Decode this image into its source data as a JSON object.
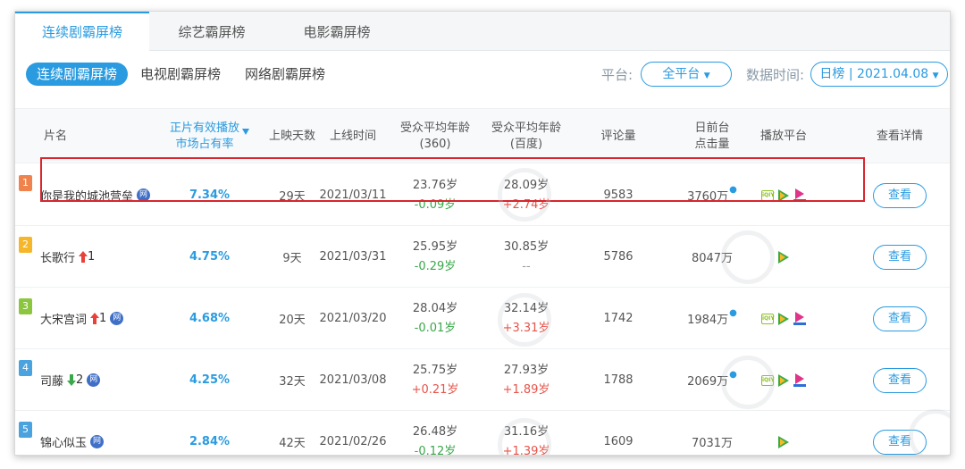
{
  "top_tabs": [
    "连续剧霸屏榜",
    "综艺霸屏榜",
    "电影霸屏榜"
  ],
  "sub_tabs": [
    "连续剧霸屏榜",
    "电视剧霸屏榜",
    "网络剧霸屏榜"
  ],
  "filters": {
    "platform_label": "平台:",
    "platform_value": "全平台",
    "date_label": "数据时间:",
    "date_value": "日榜 | 2021.04.08"
  },
  "columns": {
    "name": "片名",
    "share_line1": "正片有效播放",
    "share_line2": "市场占有率",
    "days": "上映天数",
    "release": "上线时间",
    "age360_line1": "受众平均年龄",
    "age360_line2": "(360)",
    "agebaidu_line1": "受众平均年龄",
    "agebaidu_line2": "(百度)",
    "comments": "评论量",
    "clicks_line1": "日前台",
    "clicks_line2": "点击量",
    "platforms": "播放平台",
    "detail": "查看详情"
  },
  "rows": [
    {
      "rank": "1",
      "rank_color": "#f0834d",
      "name": "你是我的城池营垒",
      "change": "",
      "change_dir": "",
      "wang": true,
      "share": "7.34%",
      "days": "29天",
      "release": "2021/03/11",
      "age360": "23.76岁",
      "age360_delta": "-0.09岁",
      "age360_dir": "down",
      "agebaidu": "28.09岁",
      "agebaidu_delta": "+2.74岁",
      "agebaidu_dir": "up",
      "comments": "9583",
      "clicks": "3760万",
      "platforms": [
        "iqiyi",
        "tencent",
        "youku"
      ],
      "detail": "查看"
    },
    {
      "rank": "2",
      "rank_color": "#f5b62a",
      "name": "长歌行",
      "change": "1",
      "change_dir": "up",
      "wang": false,
      "share": "4.75%",
      "days": "9天",
      "release": "2021/03/31",
      "age360": "25.95岁",
      "age360_delta": "-0.29岁",
      "age360_dir": "down",
      "agebaidu": "30.85岁",
      "agebaidu_delta": "--",
      "agebaidu_dir": "none",
      "comments": "5786",
      "clicks": "8047万",
      "platforms": [
        "tencent"
      ],
      "detail": "查看"
    },
    {
      "rank": "3",
      "rank_color": "#8cc63f",
      "name": "大宋宫词",
      "change": "1",
      "change_dir": "up",
      "wang": true,
      "share": "4.68%",
      "days": "20天",
      "release": "2021/03/20",
      "age360": "28.04岁",
      "age360_delta": "-0.01岁",
      "age360_dir": "down",
      "agebaidu": "32.14岁",
      "agebaidu_delta": "+3.31岁",
      "agebaidu_dir": "up",
      "comments": "1742",
      "clicks": "1984万",
      "platforms": [
        "iqiyi",
        "tencent",
        "youku"
      ],
      "detail": "查看"
    },
    {
      "rank": "4",
      "rank_color": "#4aa3df",
      "name": "司藤",
      "change": "2",
      "change_dir": "down",
      "wang": true,
      "share": "4.25%",
      "days": "32天",
      "release": "2021/03/08",
      "age360": "25.75岁",
      "age360_delta": "+0.21岁",
      "age360_dir": "up",
      "agebaidu": "27.93岁",
      "agebaidu_delta": "+1.89岁",
      "agebaidu_dir": "up",
      "comments": "1788",
      "clicks": "2069万",
      "platforms": [
        "iqiyi",
        "tencent",
        "youku"
      ],
      "detail": "查看"
    },
    {
      "rank": "5",
      "rank_color": "#4aa3df",
      "name": "锦心似玉",
      "change": "",
      "change_dir": "",
      "wang": true,
      "share": "2.84%",
      "days": "42天",
      "release": "2021/02/26",
      "age360": "26.48岁",
      "age360_delta": "-0.12岁",
      "age360_dir": "down",
      "agebaidu": "31.16岁",
      "agebaidu_delta": "+1.39岁",
      "agebaidu_dir": "up",
      "comments": "1609",
      "clicks": "7031万",
      "platforms": [
        "tencent"
      ],
      "detail": "查看"
    }
  ],
  "wang_badge": "网",
  "iqiyi_text": "iQIY",
  "colors": {
    "accent": "#2a9be0",
    "up": "#e8534a",
    "down": "#3aa84a",
    "highlight": "#d8262e"
  }
}
